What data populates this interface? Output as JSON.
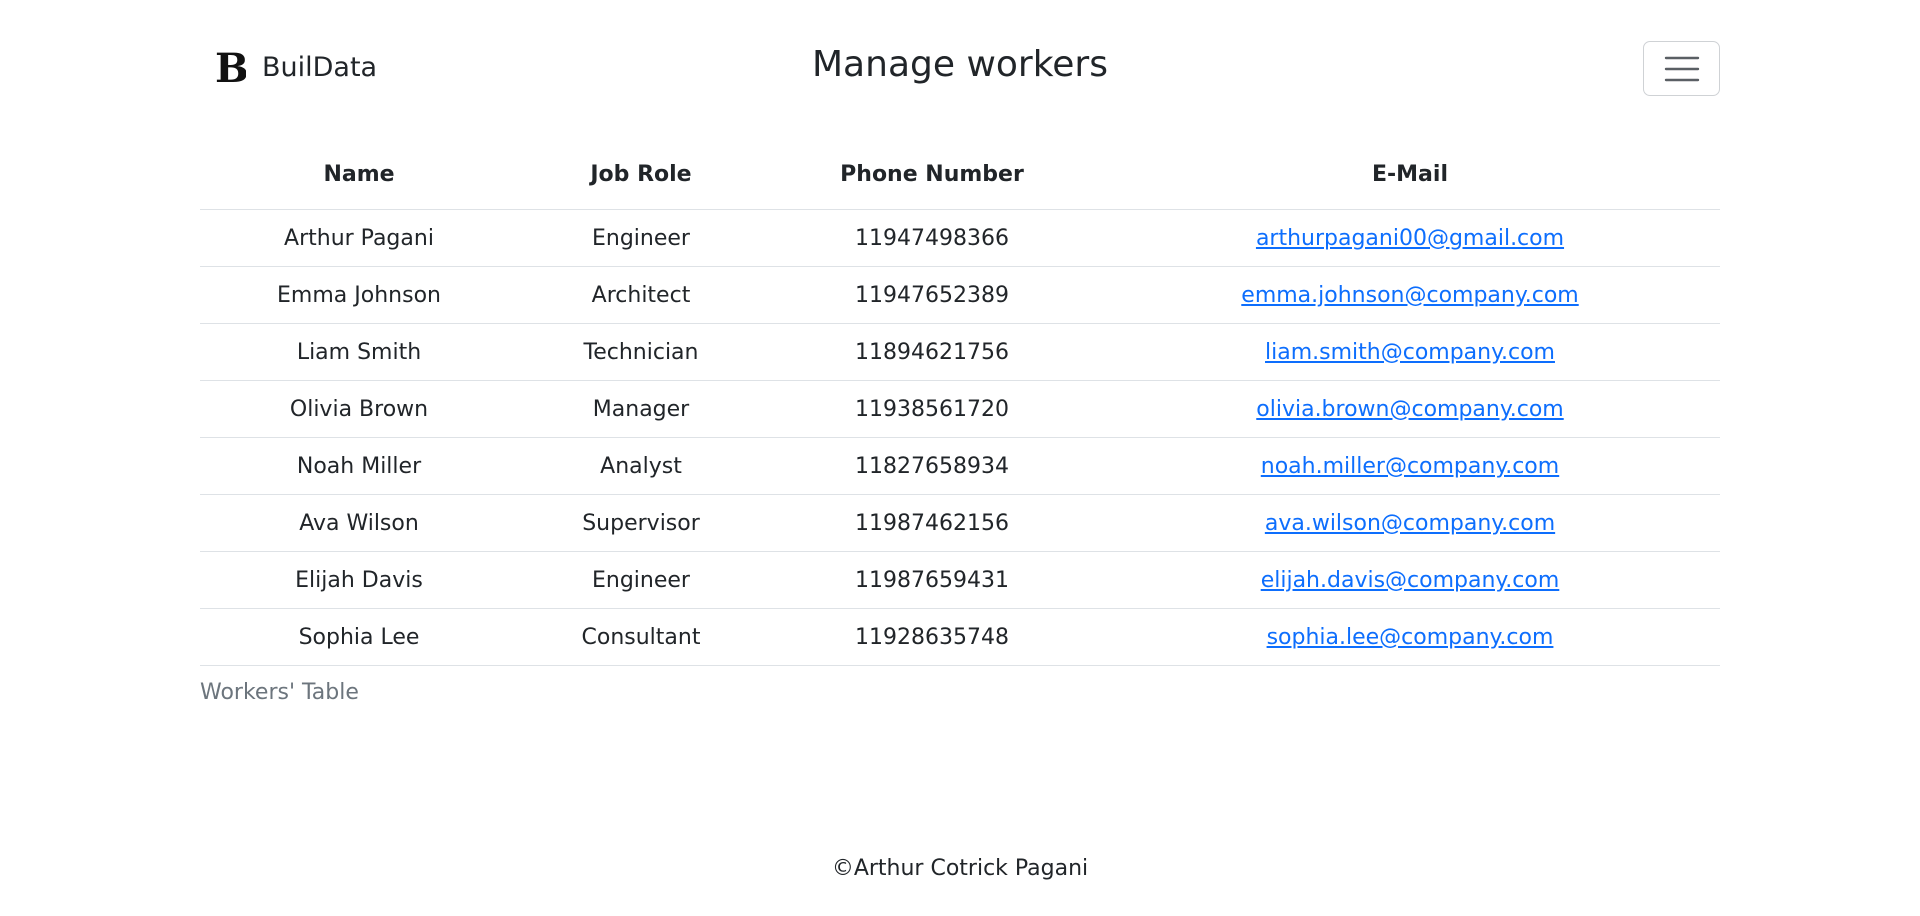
{
  "brand": {
    "logo_letter": "B",
    "name": "BuilData"
  },
  "page": {
    "title": "Manage workers"
  },
  "nav": {
    "toggle_icon": "hamburger-menu-icon"
  },
  "table": {
    "columns": [
      "Name",
      "Job Role",
      "Phone Number",
      "E-Mail"
    ],
    "rows": [
      {
        "name": "Arthur Pagani",
        "role": "Engineer",
        "phone": "11947498366",
        "email": "arthurpagani00@gmail.com"
      },
      {
        "name": "Emma Johnson",
        "role": "Architect",
        "phone": "11947652389",
        "email": "emma.johnson@company.com"
      },
      {
        "name": "Liam Smith",
        "role": "Technician",
        "phone": "11894621756",
        "email": "liam.smith@company.com"
      },
      {
        "name": "Olivia Brown",
        "role": "Manager",
        "phone": "11938561720",
        "email": "olivia.brown@company.com"
      },
      {
        "name": "Noah Miller",
        "role": "Analyst",
        "phone": "11827658934",
        "email": "noah.miller@company.com"
      },
      {
        "name": "Ava Wilson",
        "role": "Supervisor",
        "phone": "11987462156",
        "email": "ava.wilson@company.com"
      },
      {
        "name": "Elijah Davis",
        "role": "Engineer",
        "phone": "11987659431",
        "email": "elijah.davis@company.com"
      },
      {
        "name": "Sophia Lee",
        "role": "Consultant",
        "phone": "11928635748",
        "email": "sophia.lee@company.com"
      }
    ],
    "caption": "Workers' Table"
  },
  "footer": {
    "text": "©Arthur Cotrick Pagani"
  },
  "colors": {
    "link": "#0d6efd",
    "muted": "#6c757d",
    "text": "#212529",
    "border": "#dee2e6"
  }
}
